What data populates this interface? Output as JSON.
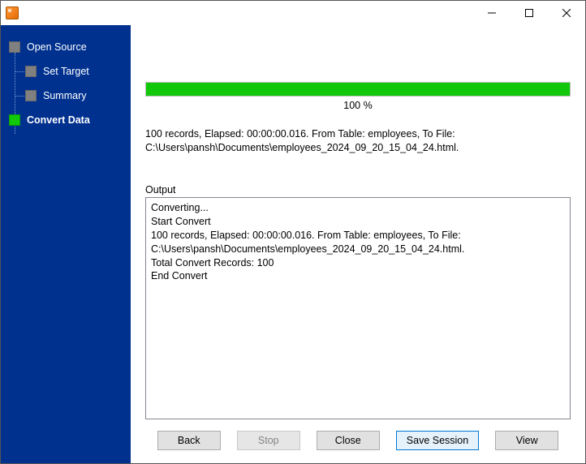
{
  "window": {
    "title": ""
  },
  "sidebar": {
    "steps": [
      {
        "label": "Open Source",
        "active": false
      },
      {
        "label": "Set Target",
        "active": false
      },
      {
        "label": "Summary",
        "active": false
      },
      {
        "label": "Convert Data",
        "active": true
      }
    ]
  },
  "progress": {
    "percent_value": 100,
    "percent_label": "100 %"
  },
  "status": {
    "line1": "100 records,    Elapsed: 00:00:00.016.    From Table: employees,    To File:",
    "line2": "C:\\Users\\pansh\\Documents\\employees_2024_09_20_15_04_24.html."
  },
  "output": {
    "label": "Output",
    "lines": [
      "Converting...",
      "Start Convert",
      "100 records,    Elapsed: 00:00:00.016.    From Table: employees,    To File: C:\\Users\\pansh\\Documents\\employees_2024_09_20_15_04_24.html.",
      "Total Convert Records: 100",
      "End Convert"
    ]
  },
  "buttons": {
    "back": "Back",
    "stop": "Stop",
    "close": "Close",
    "save_session": "Save Session",
    "view": "View"
  }
}
